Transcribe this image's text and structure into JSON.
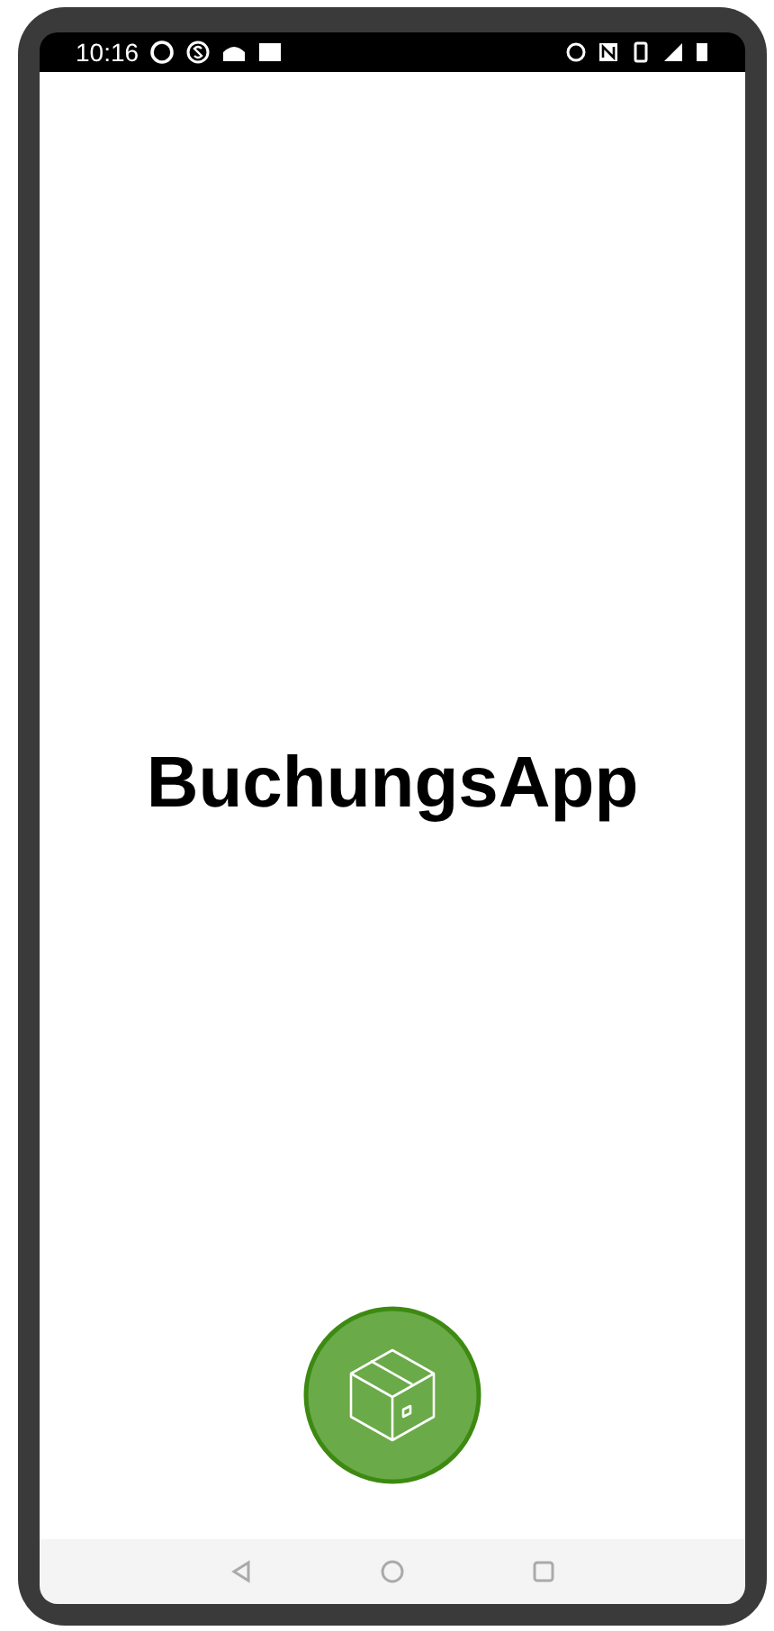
{
  "status_bar": {
    "time": "10:16"
  },
  "app_title": "BuchungsApp"
}
